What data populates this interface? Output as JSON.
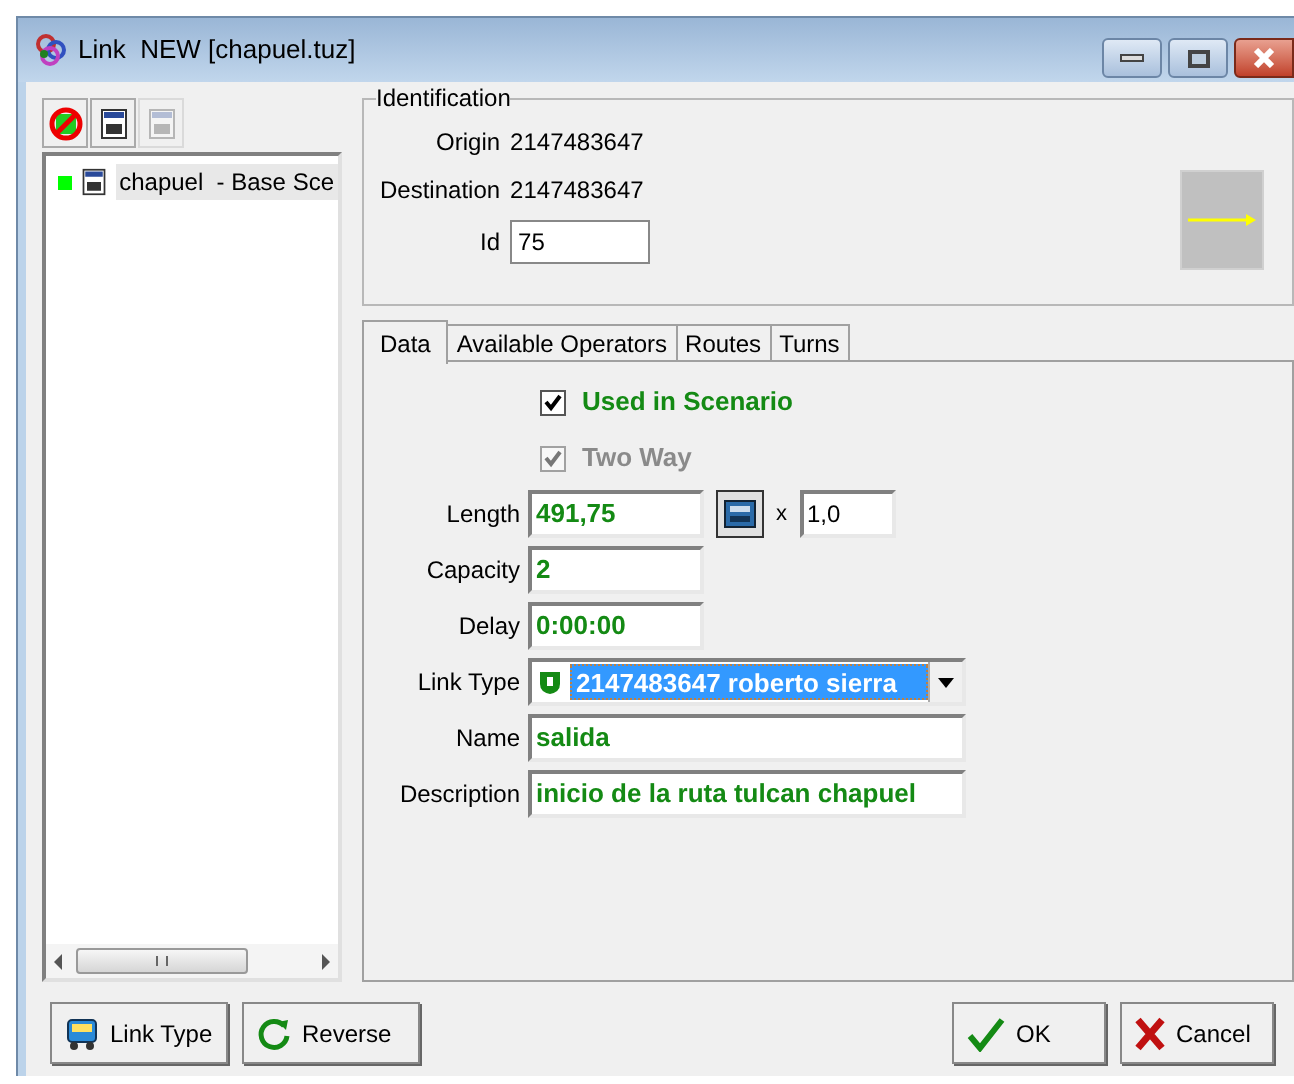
{
  "window": {
    "title": "Link  NEW [chapuel.tuz]"
  },
  "toolbar": [
    {
      "kind": "delete",
      "disabled": false
    },
    {
      "kind": "scenario",
      "disabled": false
    },
    {
      "kind": "scenario",
      "disabled": true
    }
  ],
  "scenarios": [
    {
      "name": "chapuel  - Base Sce",
      "selected": true,
      "color": "#00ff00"
    }
  ],
  "identification": {
    "title": "Identification",
    "fields": [
      {
        "kind": "text",
        "label": "Origin",
        "value": "2147483647"
      },
      {
        "kind": "text",
        "label": "Destination",
        "value": "2147483647"
      },
      {
        "kind": "input",
        "label": "Id",
        "value": "75"
      }
    ]
  },
  "tabs": [
    {
      "label": "Data",
      "selected": true
    },
    {
      "label": "Available Operators",
      "selected": false
    },
    {
      "label": "Routes",
      "selected": false
    },
    {
      "label": "Turns",
      "selected": false
    }
  ],
  "rows": [
    {
      "kind": "checkbox",
      "label": "Used in Scenario",
      "checked": true,
      "disabled": false
    },
    {
      "kind": "checkbox",
      "label": "Two Way",
      "checked": true,
      "disabled": true
    },
    {
      "kind": "calc",
      "label": "Length",
      "value": "491,75",
      "multiplier_label": "x",
      "multiplier": "1,0"
    },
    {
      "kind": "field",
      "label": "Capacity",
      "value": "2"
    },
    {
      "kind": "field",
      "label": "Delay",
      "value": "0:00:00"
    },
    {
      "kind": "combo",
      "label": "Link Type",
      "value": "2147483647 roberto sierra"
    },
    {
      "kind": "wide",
      "label": "Name",
      "value": "salida"
    },
    {
      "kind": "wide",
      "label": "Description",
      "value": "inicio de la ruta tulcan chapuel"
    }
  ],
  "left_buttons": [
    {
      "kind": "bus",
      "label": "Link Type"
    },
    {
      "kind": "reverse",
      "label": "Reverse"
    }
  ],
  "right_buttons": [
    {
      "kind": "ok",
      "label": "OK"
    },
    {
      "kind": "cancel",
      "label": "Cancel"
    }
  ]
}
